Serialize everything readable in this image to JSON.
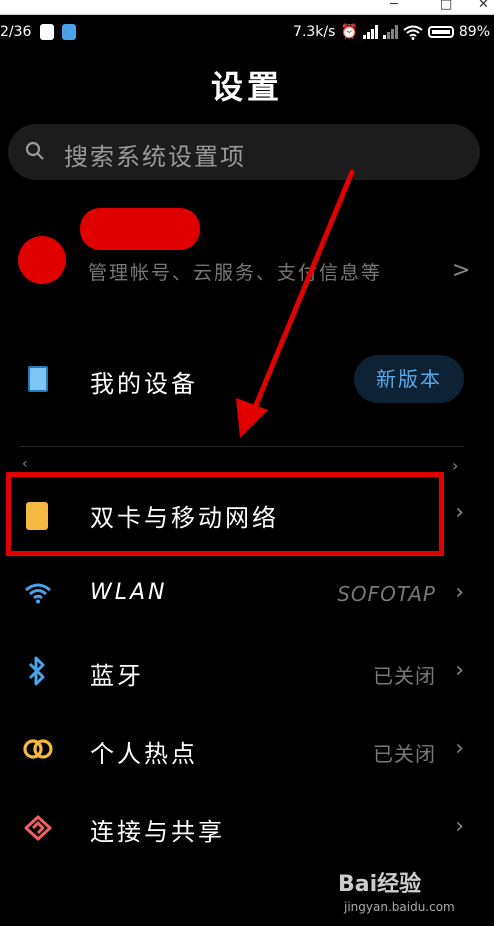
{
  "status_bar": {
    "time": "2/36",
    "speed": "7.3k/s",
    "battery": "89%"
  },
  "page": {
    "title": "设置"
  },
  "search": {
    "placeholder": "搜索系统设置项"
  },
  "account": {
    "subtitle": "管理帐号、云服务、支付信息等"
  },
  "my_device": {
    "label": "我的设备",
    "badge": "新版本"
  },
  "items": [
    {
      "label": "双卡与移动网络",
      "value": ""
    },
    {
      "label": "WLAN",
      "value": "SOFOTAP"
    },
    {
      "label": "蓝牙",
      "value": "已关闭"
    },
    {
      "label": "个人热点",
      "value": "已关闭"
    },
    {
      "label": "连接与共享",
      "value": ""
    }
  ],
  "watermark": {
    "brand": "Bai经验",
    "url": "jingyan.baidu.com"
  },
  "colors": {
    "highlight": "#e00000",
    "accent": "#5ba9ea"
  }
}
